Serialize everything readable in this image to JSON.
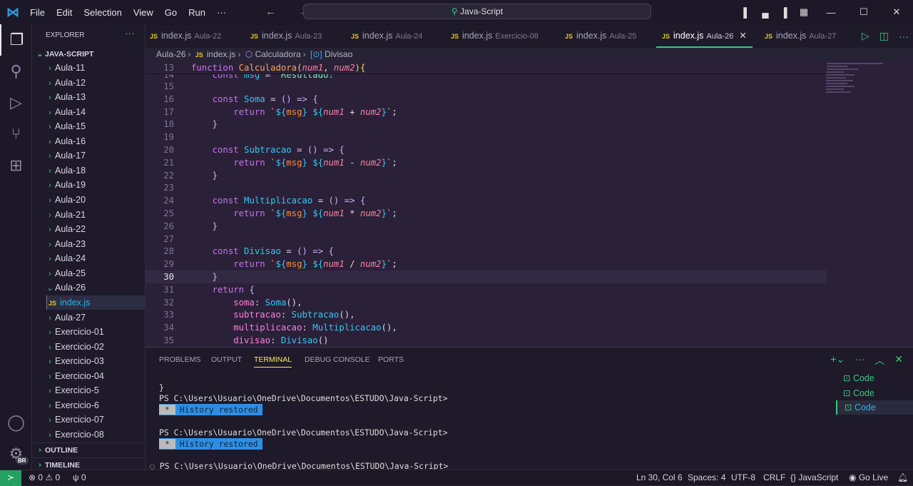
{
  "titlebar": {
    "menu": [
      "File",
      "Edit",
      "Selection",
      "View",
      "Go",
      "Run",
      "···"
    ],
    "search": "Java-Script",
    "nav": "← →"
  },
  "sidebar": {
    "title": "EXPLORER",
    "more": "···",
    "root": "JAVA-SCRIPT",
    "items": [
      {
        "label": "Aula-11"
      },
      {
        "label": "Aula-12"
      },
      {
        "label": "Aula-13"
      },
      {
        "label": "Aula-14"
      },
      {
        "label": "Aula-15"
      },
      {
        "label": "Aula-16"
      },
      {
        "label": "Aula-17"
      },
      {
        "label": "Aula-18"
      },
      {
        "label": "Aula-19"
      },
      {
        "label": "Aula-20"
      },
      {
        "label": "Aula-21"
      },
      {
        "label": "Aula-22"
      },
      {
        "label": "Aula-23"
      },
      {
        "label": "Aula-24"
      },
      {
        "label": "Aula-25"
      },
      {
        "label": "Aula-26",
        "expanded": true
      },
      {
        "label": "index.js",
        "file": true,
        "selected": true
      },
      {
        "label": "Aula-27"
      },
      {
        "label": "Exercicio-01"
      },
      {
        "label": "Exercicio-02"
      },
      {
        "label": "Exercicio-03"
      },
      {
        "label": "Exercicio-04"
      },
      {
        "label": "Exercicio-5"
      },
      {
        "label": "Exercicio-6"
      },
      {
        "label": "Exercicio-07"
      },
      {
        "label": "Exercicio-08"
      }
    ],
    "sections": [
      "OUTLINE",
      "TIMELINE"
    ],
    "account_badge": "BR"
  },
  "tabs": [
    {
      "file": "index.js",
      "folder": "Aula-22"
    },
    {
      "file": "index.js",
      "folder": "Aula-23"
    },
    {
      "file": "index.js",
      "folder": "Aula-24"
    },
    {
      "file": "index.js",
      "folder": "Exercicio-08"
    },
    {
      "file": "index.js",
      "folder": "Aula-25"
    },
    {
      "file": "index.js",
      "folder": "Aula-26",
      "active": true
    },
    {
      "file": "index.js",
      "folder": "Aula-27"
    }
  ],
  "breadcrumb": [
    "Aula-26",
    "index.js",
    "Calculadora",
    "Divisao"
  ],
  "editor": {
    "current_line": 30,
    "lines": [
      {
        "n": 13,
        "t": [
          [
            "function ",
            "k"
          ],
          [
            "Calculadora",
            "f"
          ],
          [
            "(",
            "b"
          ],
          [
            "num1",
            "p"
          ],
          [
            ", ",
            "o"
          ],
          [
            "num2",
            "p"
          ],
          [
            ")",
            "b"
          ],
          [
            "{",
            "b"
          ]
        ]
      },
      {
        "n": 14,
        "t": [
          [
            "    const ",
            "k"
          ],
          [
            "msg",
            "v"
          ],
          [
            " = ",
            "o"
          ],
          [
            "'Resultado:'",
            "g"
          ]
        ]
      },
      {
        "n": 15,
        "t": []
      },
      {
        "n": 16,
        "t": [
          [
            "    const ",
            "k"
          ],
          [
            "Soma",
            "v"
          ],
          [
            " = ",
            "o"
          ],
          [
            "() => ",
            "br2"
          ],
          [
            "{",
            "br2"
          ]
        ]
      },
      {
        "n": 17,
        "t": [
          [
            "        return ",
            "k"
          ],
          [
            "`",
            "s"
          ],
          [
            "${",
            "v"
          ],
          [
            "msg",
            "t"
          ],
          [
            "}",
            "v"
          ],
          [
            " ",
            "s"
          ],
          [
            "${",
            "v"
          ],
          [
            "num1",
            "p"
          ],
          [
            " + ",
            "o"
          ],
          [
            "num2",
            "p"
          ],
          [
            "}",
            "v"
          ],
          [
            "`",
            "s"
          ],
          [
            ";",
            "o"
          ]
        ]
      },
      {
        "n": 18,
        "t": [
          [
            "    }",
            "br2"
          ]
        ]
      },
      {
        "n": 19,
        "t": []
      },
      {
        "n": 20,
        "t": [
          [
            "    const ",
            "k"
          ],
          [
            "Subtracao",
            "v"
          ],
          [
            " = ",
            "o"
          ],
          [
            "() => ",
            "br2"
          ],
          [
            "{",
            "br2"
          ]
        ]
      },
      {
        "n": 21,
        "t": [
          [
            "        return ",
            "k"
          ],
          [
            "`",
            "s"
          ],
          [
            "${",
            "v"
          ],
          [
            "msg",
            "t"
          ],
          [
            "}",
            "v"
          ],
          [
            " ",
            "s"
          ],
          [
            "${",
            "v"
          ],
          [
            "num1",
            "p"
          ],
          [
            " - ",
            "o"
          ],
          [
            "num2",
            "p"
          ],
          [
            "}",
            "v"
          ],
          [
            "`",
            "s"
          ],
          [
            ";",
            "o"
          ]
        ]
      },
      {
        "n": 22,
        "t": [
          [
            "    }",
            "br2"
          ]
        ]
      },
      {
        "n": 23,
        "t": []
      },
      {
        "n": 24,
        "t": [
          [
            "    const ",
            "k"
          ],
          [
            "Multiplicacao",
            "v"
          ],
          [
            " = ",
            "o"
          ],
          [
            "() => ",
            "br2"
          ],
          [
            "{",
            "br2"
          ]
        ]
      },
      {
        "n": 25,
        "t": [
          [
            "        return ",
            "k"
          ],
          [
            "`",
            "s"
          ],
          [
            "${",
            "v"
          ],
          [
            "msg",
            "t"
          ],
          [
            "}",
            "v"
          ],
          [
            " ",
            "s"
          ],
          [
            "${",
            "v"
          ],
          [
            "num1",
            "p"
          ],
          [
            " * ",
            "o"
          ],
          [
            "num2",
            "p"
          ],
          [
            "}",
            "v"
          ],
          [
            "`",
            "s"
          ],
          [
            ";",
            "o"
          ]
        ]
      },
      {
        "n": 26,
        "t": [
          [
            "    }",
            "br2"
          ]
        ]
      },
      {
        "n": 27,
        "t": []
      },
      {
        "n": 28,
        "t": [
          [
            "    const ",
            "k"
          ],
          [
            "Divisao",
            "v"
          ],
          [
            " = ",
            "o"
          ],
          [
            "() => ",
            "br2"
          ],
          [
            "{",
            "br2"
          ]
        ]
      },
      {
        "n": 29,
        "t": [
          [
            "        return ",
            "k"
          ],
          [
            "`",
            "s"
          ],
          [
            "${",
            "v"
          ],
          [
            "msg",
            "t"
          ],
          [
            "}",
            "v"
          ],
          [
            " ",
            "s"
          ],
          [
            "${",
            "v"
          ],
          [
            "num1",
            "p"
          ],
          [
            " / ",
            "o"
          ],
          [
            "num2",
            "p"
          ],
          [
            "}",
            "v"
          ],
          [
            "`",
            "s"
          ],
          [
            ";",
            "o"
          ]
        ]
      },
      {
        "n": 30,
        "t": [
          [
            "    }",
            "br2"
          ]
        ]
      },
      {
        "n": 31,
        "t": [
          [
            "    return ",
            "k"
          ],
          [
            "{",
            "br2"
          ]
        ]
      },
      {
        "n": 32,
        "t": [
          [
            "        soma",
            "prop"
          ],
          [
            ": ",
            "o"
          ],
          [
            "Soma",
            "v"
          ],
          [
            "(),",
            "o"
          ]
        ]
      },
      {
        "n": 33,
        "t": [
          [
            "        subtracao",
            "prop"
          ],
          [
            ": ",
            "o"
          ],
          [
            "Subtracao",
            "v"
          ],
          [
            "(),",
            "o"
          ]
        ]
      },
      {
        "n": 34,
        "t": [
          [
            "        multiplicacao",
            "prop"
          ],
          [
            ": ",
            "o"
          ],
          [
            "Multiplicacao",
            "v"
          ],
          [
            "(),",
            "o"
          ]
        ]
      },
      {
        "n": 35,
        "t": [
          [
            "        divisao",
            "prop"
          ],
          [
            ": ",
            "o"
          ],
          [
            "Divisao",
            "v"
          ],
          [
            "()",
            "o"
          ]
        ]
      }
    ]
  },
  "panel": {
    "tabs": [
      "PROBLEMS",
      "OUTPUT",
      "TERMINAL",
      "DEBUG CONSOLE",
      "PORTS"
    ],
    "active_tab": "TERMINAL",
    "terminal": {
      "brace": "}",
      "prompt": "PS C:\\Users\\Usuario\\OneDrive\\Documentos\\ESTUDO\\Java-Script>",
      "history_star": "*",
      "history": "History restored"
    },
    "terminals": [
      "Code",
      "Code",
      "Code"
    ]
  },
  "status": {
    "errors": "0",
    "warnings": "0",
    "ports": "0",
    "position": "Ln 30, Col 6",
    "spaces": "Spaces: 4",
    "encoding": "UTF-8",
    "eol": "CRLF",
    "language": "JavaScript",
    "golive": "Go Live"
  },
  "colors": {
    "accent": "#3ec47f",
    "editor_bg": "#2a2139",
    "selection": "#29b5e8"
  }
}
